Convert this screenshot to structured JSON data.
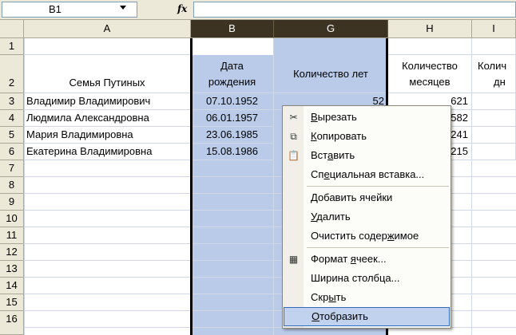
{
  "formula_bar": {
    "name_box": "B1",
    "fx_label": "fx"
  },
  "columns": [
    "A",
    "B",
    "G",
    "H",
    "I"
  ],
  "rows": [
    "1",
    "2",
    "3",
    "4",
    "5",
    "6",
    "7",
    "8",
    "9",
    "10",
    "11",
    "12",
    "13",
    "14",
    "15",
    "16"
  ],
  "header_row": {
    "family": "Семья Путиных",
    "birth_date_line1": "Дата",
    "birth_date_line2": "рождения",
    "years": "Количество лет",
    "months_line1": "Количество",
    "months_line2": "месяцев",
    "days_line1": "Колич",
    "days_line2": "дн"
  },
  "data_rows": [
    {
      "name": "Владимир Владимирович",
      "date": "07.10.1952",
      "years": "52",
      "months": "621"
    },
    {
      "name": "Людмила Александровна",
      "date": "06.01.1957",
      "years": "",
      "months": "582"
    },
    {
      "name": "Мария Владимировна",
      "date": "23.06.1985",
      "years": "",
      "months": "241"
    },
    {
      "name": "Екатерина Владимировна",
      "date": "15.08.1986",
      "years": "",
      "months": "215"
    }
  ],
  "context_menu": {
    "cut": {
      "ul": "В",
      "rest": "ырезать"
    },
    "copy": {
      "ul": "К",
      "rest": "опировать"
    },
    "paste": {
      "pre": "Вст",
      "ul": "а",
      "rest": "вить"
    },
    "paste_special": {
      "pre": "Сп",
      "ul": "е",
      "rest": "циальная вставка..."
    },
    "insert_cells": {
      "ul": "Д",
      "rest": "обавить ячейки"
    },
    "delete": {
      "ul": "У",
      "rest": "далить"
    },
    "clear_contents": {
      "pre": "Очистить содер",
      "ul": "ж",
      "rest": "имое"
    },
    "format_cells": {
      "pre": "Формат ",
      "ul": "я",
      "rest": "чеек..."
    },
    "column_width": {
      "pre": "Ширина столбца",
      "ul": "",
      "rest": "..."
    },
    "hide": {
      "pre": "Скр",
      "ul": "ы",
      "rest": "ть"
    },
    "unhide": {
      "ul": "О",
      "rest": "тобразить"
    }
  }
}
